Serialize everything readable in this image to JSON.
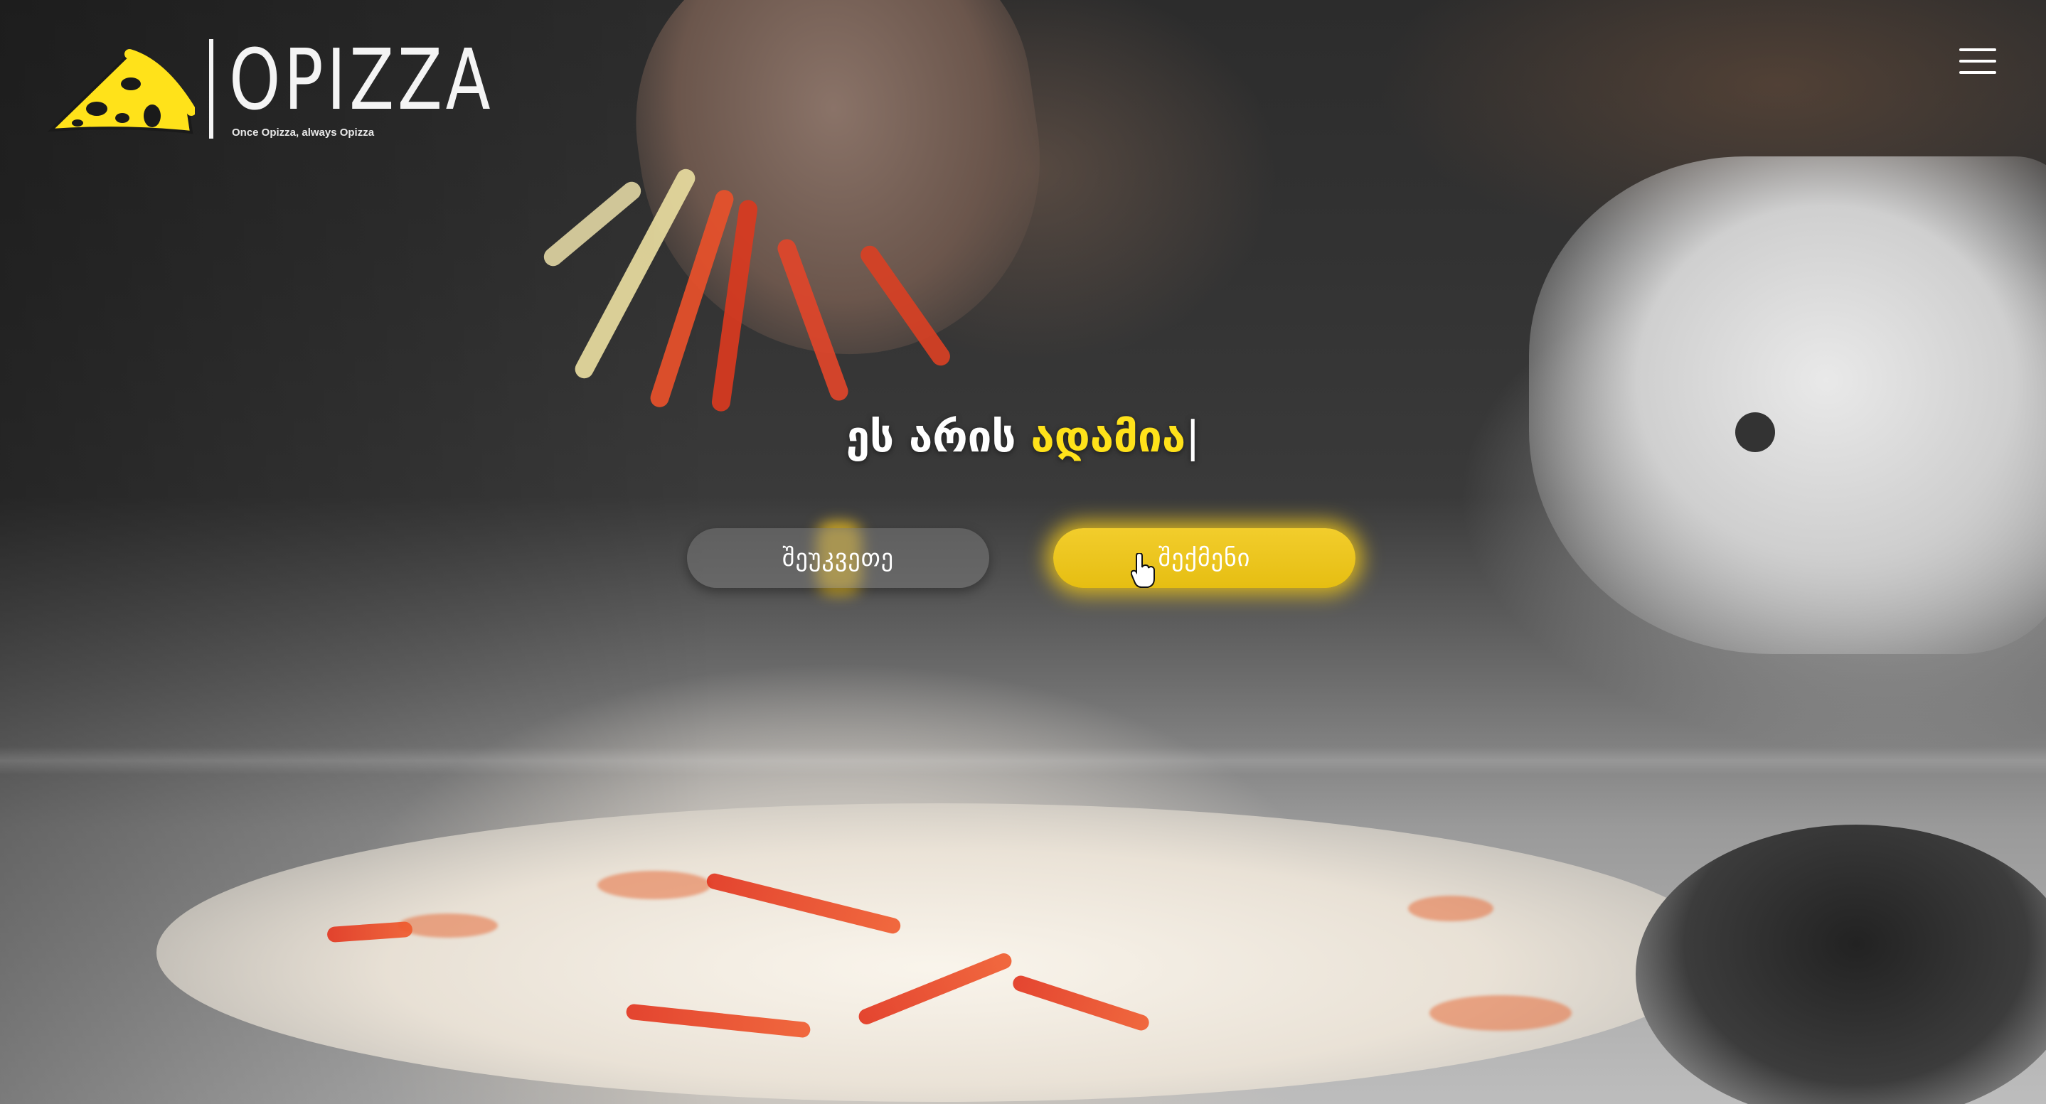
{
  "brand": {
    "title": "OPIZZA",
    "tagline": "Once Opizza, always Opizza",
    "logo_icon": "pizza-slice-icon",
    "accent_color": "#ffe21a"
  },
  "header": {
    "menu_icon": "hamburger-menu-icon"
  },
  "hero": {
    "headline_prefix": "ეს არის ",
    "headline_accent": "ადამია",
    "headline_caret": "|"
  },
  "buttons": {
    "secondary_label": "შეუკვეთე",
    "primary_label": "შექმენი",
    "primary_color": "#f2cd2c"
  },
  "cursor": {
    "icon": "hand-pointer-icon"
  }
}
